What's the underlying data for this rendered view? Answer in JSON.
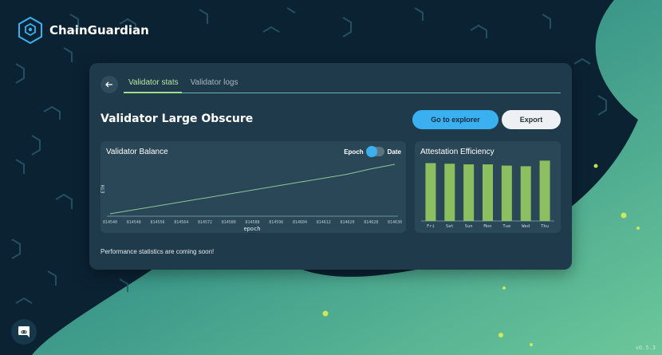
{
  "app": {
    "title": "ChainGuardian",
    "version": "v0.5.3"
  },
  "colors": {
    "accent_blue": "#3ab0f0",
    "accent_green": "#9ee08a",
    "card_bg": "#1f3a4a",
    "panel_bg": "#2a4757",
    "bar_green": "#8cbf5f"
  },
  "nav": {
    "tabs": [
      {
        "label": "Validator stats",
        "active": true
      },
      {
        "label": "Validator logs",
        "active": false
      }
    ]
  },
  "page": {
    "title": "Validator Large Obscure",
    "explorer_label": "Go to explorer",
    "export_label": "Export",
    "note": "Performance statistics are coming soon!"
  },
  "balance_panel": {
    "title": "Validator Balance",
    "toggle_left": "Epoch",
    "toggle_right": "Date",
    "toggle_state": "Epoch"
  },
  "attestation_panel": {
    "title": "Attestation Efficiency"
  },
  "chart_data": [
    {
      "type": "line",
      "title": "Validator Balance",
      "xlabel": "epoch",
      "ylabel": "ETH",
      "x": [
        "814540",
        "814548",
        "814556",
        "814564",
        "814572",
        "814580",
        "814588",
        "814596",
        "814604",
        "814612",
        "814620",
        "814628",
        "814630"
      ],
      "series": [
        {
          "values": [
            0.0,
            0.08,
            0.16,
            0.24,
            0.32,
            0.4,
            0.48,
            0.56,
            0.64,
            0.72,
            0.8,
            0.91,
            1.0
          ]
        }
      ],
      "grid": false
    },
    {
      "type": "bar",
      "title": "Attestation Efficiency",
      "categories": [
        "Fri",
        "Sat",
        "Sun",
        "Mon",
        "Tue",
        "Wed",
        "Thu"
      ],
      "values": [
        0.93,
        0.92,
        0.91,
        0.91,
        0.89,
        0.88,
        0.97
      ],
      "ylim": [
        0,
        1
      ],
      "grid": false
    }
  ]
}
